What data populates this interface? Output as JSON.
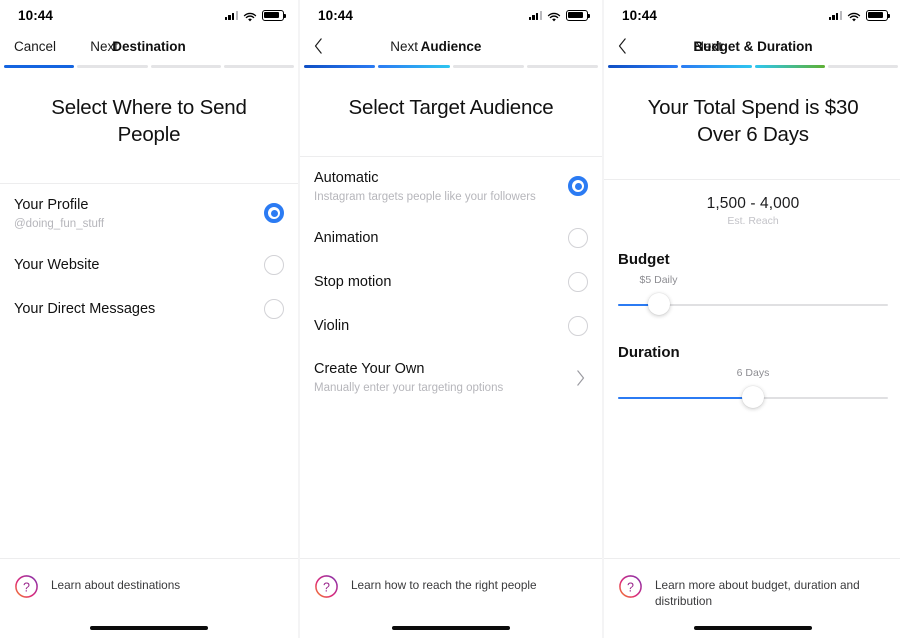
{
  "colors": {
    "accent_blue": "#2b7bf3",
    "progress_blue": "#1464e0",
    "progress_cyan": "#2ec6f0",
    "progress_green": "#5eb033",
    "muted_text": "#b6b6bb",
    "divider": "#ededee"
  },
  "panels": [
    {
      "id": "destination",
      "statusbar": {
        "time": "10:44",
        "signal_icon": "cellular-signal-icon",
        "wifi_icon": "wifi-icon",
        "battery_icon": "battery-icon"
      },
      "nav": {
        "left_label": "Cancel",
        "title": "Destination",
        "right_label": "Next",
        "left_is_chevron": false
      },
      "progress": {
        "total": 4,
        "filled": 1
      },
      "headline": "Select Where to Send People",
      "options": [
        {
          "title": "Your Profile",
          "subtitle": "@doing_fun_stuff",
          "control": "radio",
          "selected": true
        },
        {
          "title": "Your Website",
          "subtitle": "",
          "control": "radio",
          "selected": false
        },
        {
          "title": "Your Direct Messages",
          "subtitle": "",
          "control": "radio",
          "selected": false
        }
      ],
      "footer": {
        "icon": "help-question-icon",
        "text": "Learn about destinations"
      }
    },
    {
      "id": "audience",
      "statusbar": {
        "time": "10:44",
        "signal_icon": "cellular-signal-icon",
        "wifi_icon": "wifi-icon",
        "battery_icon": "battery-icon"
      },
      "nav": {
        "left_label": "Back",
        "title": "Audience",
        "right_label": "Next",
        "left_is_chevron": true
      },
      "progress": {
        "total": 4,
        "filled": 2
      },
      "headline": "Select Target Audience",
      "options": [
        {
          "title": "Automatic",
          "subtitle": "Instagram targets people like your followers",
          "control": "radio",
          "selected": true
        },
        {
          "title": "Animation",
          "subtitle": "",
          "control": "radio",
          "selected": false
        },
        {
          "title": "Stop motion",
          "subtitle": "",
          "control": "radio",
          "selected": false
        },
        {
          "title": "Violin",
          "subtitle": "",
          "control": "radio",
          "selected": false
        },
        {
          "title": "Create Your Own",
          "subtitle": "Manually enter your targeting options",
          "control": "chevron",
          "selected": false
        }
      ],
      "footer": {
        "icon": "help-question-icon",
        "text": "Learn how to reach the right people"
      }
    },
    {
      "id": "budget-duration",
      "statusbar": {
        "time": "10:44",
        "signal_icon": "cellular-signal-icon",
        "wifi_icon": "wifi-icon",
        "battery_icon": "battery-icon"
      },
      "nav": {
        "left_label": "Back",
        "title": "Budget & Duration",
        "right_label": "Next",
        "left_is_chevron": true
      },
      "progress": {
        "total": 4,
        "filled": 3
      },
      "headline": "Your Total Spend is $30 Over 6 Days",
      "reach": {
        "value": "1,500 - 4,000",
        "label": "Est. Reach"
      },
      "sliders": [
        {
          "label": "Budget",
          "value_text": "$5 Daily",
          "percent": 15
        },
        {
          "label": "Duration",
          "value_text": "6 Days",
          "percent": 50
        }
      ],
      "footer": {
        "icon": "help-question-icon",
        "text": "Learn more about budget, duration and distribution"
      }
    }
  ]
}
